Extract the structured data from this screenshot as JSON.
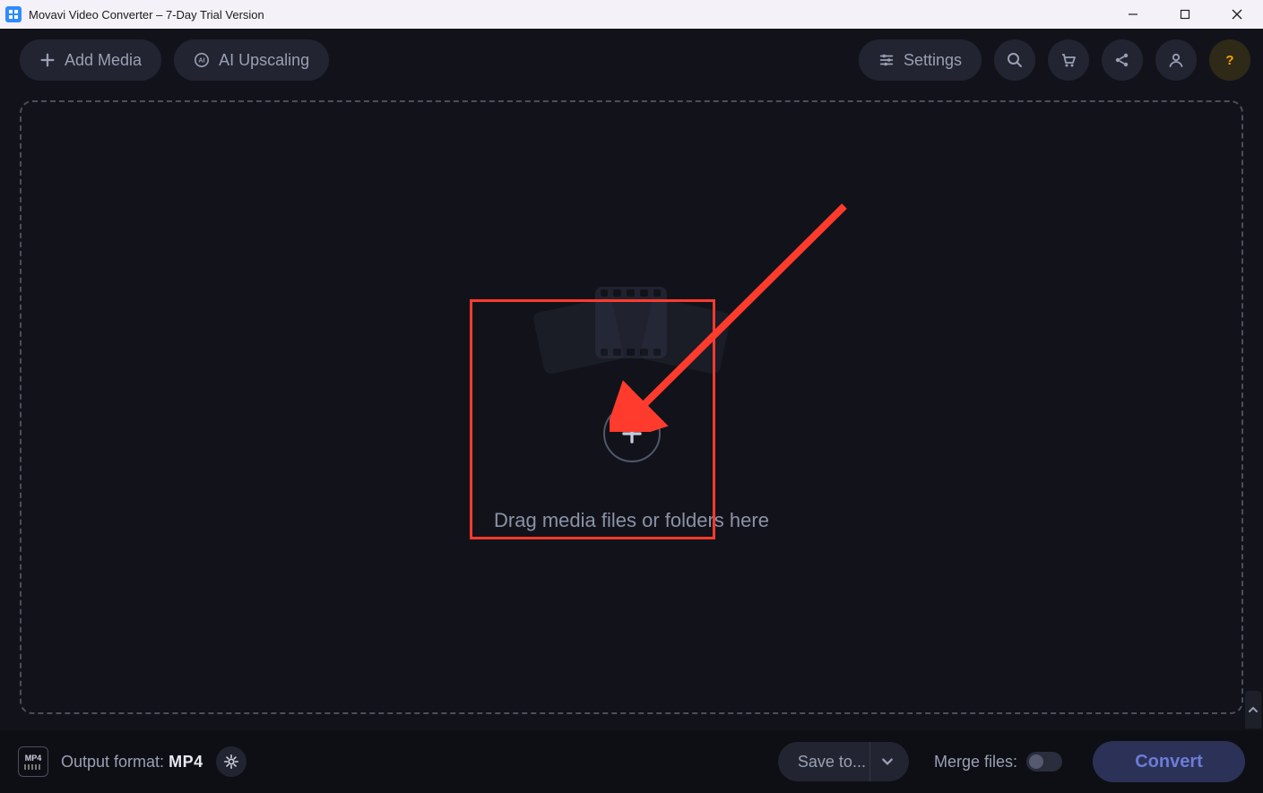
{
  "window": {
    "title": "Movavi Video Converter – 7-Day Trial Version"
  },
  "toolbar": {
    "add_media_label": "Add Media",
    "ai_upscaling_label": "AI Upscaling",
    "settings_label": "Settings"
  },
  "dropzone": {
    "hint": "Drag media files or folders here"
  },
  "bottom": {
    "output_format_label": "Output format:",
    "output_format_value": "MP4",
    "save_to_label": "Save to...",
    "merge_files_label": "Merge files:",
    "convert_label": "Convert"
  }
}
